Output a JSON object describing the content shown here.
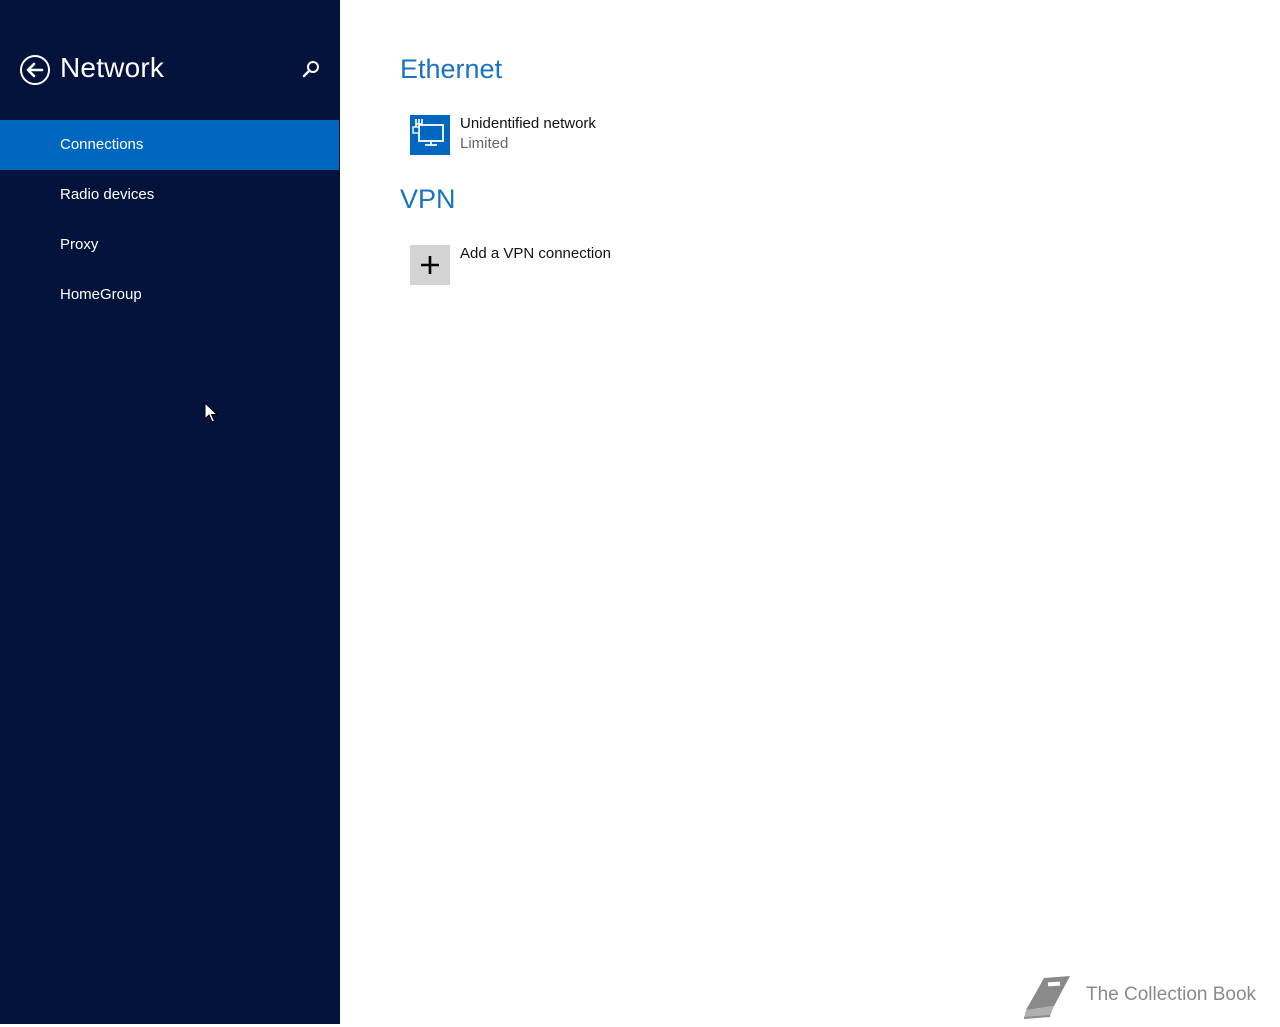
{
  "sidebar": {
    "title": "Network",
    "back_icon": "back-arrow-icon",
    "search_icon": "search-icon",
    "items": [
      {
        "label": "Connections",
        "selected": true
      },
      {
        "label": "Radio devices",
        "selected": false
      },
      {
        "label": "Proxy",
        "selected": false
      },
      {
        "label": "HomeGroup",
        "selected": false
      }
    ]
  },
  "main": {
    "sections": [
      {
        "title": "Ethernet",
        "items": [
          {
            "icon": "ethernet-network-icon",
            "name": "Unidentified network",
            "status": "Limited"
          }
        ]
      },
      {
        "title": "VPN",
        "items": [
          {
            "icon": "plus-icon",
            "name": "Add a VPN connection"
          }
        ]
      }
    ]
  },
  "watermark": {
    "text": "The Collection Book",
    "icon": "book-icon"
  },
  "colors": {
    "sidebar_bg": "#03133b",
    "accent": "#0067c0",
    "section_title": "#1a73c0",
    "tile_gray": "#d4d4d4"
  }
}
